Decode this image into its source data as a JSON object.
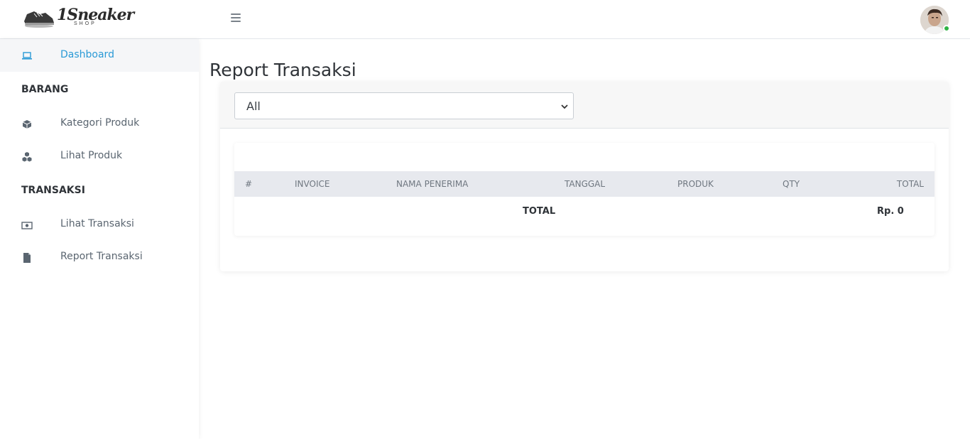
{
  "brand": {
    "name": "1Sneaker",
    "sub": "SHOP"
  },
  "sidebar": {
    "items": [
      {
        "label": "Dashboard",
        "icon": "laptop-icon"
      },
      {
        "label": "Kategori Produk",
        "icon": "box-icon"
      },
      {
        "label": "Lihat Produk",
        "icon": "boxes-icon"
      },
      {
        "label": "Lihat Transaksi",
        "icon": "money-icon"
      },
      {
        "label": "Report Transaksi",
        "icon": "file-icon"
      }
    ],
    "headings": [
      "BARANG",
      "TRANSAKSI"
    ]
  },
  "main": {
    "title": "Report Transaksi",
    "filter": {
      "selected": "All"
    },
    "table": {
      "columns": [
        "#",
        "INVOICE",
        "NAMA PENERIMA",
        "TANGGAL",
        "PRODUK",
        "QTY",
        "TOTAL"
      ],
      "rows": [],
      "footer": {
        "label": "TOTAL",
        "value": "Rp. 0"
      }
    }
  },
  "colors": {
    "accent": "#2a9ad6",
    "online": "#2fb344"
  }
}
